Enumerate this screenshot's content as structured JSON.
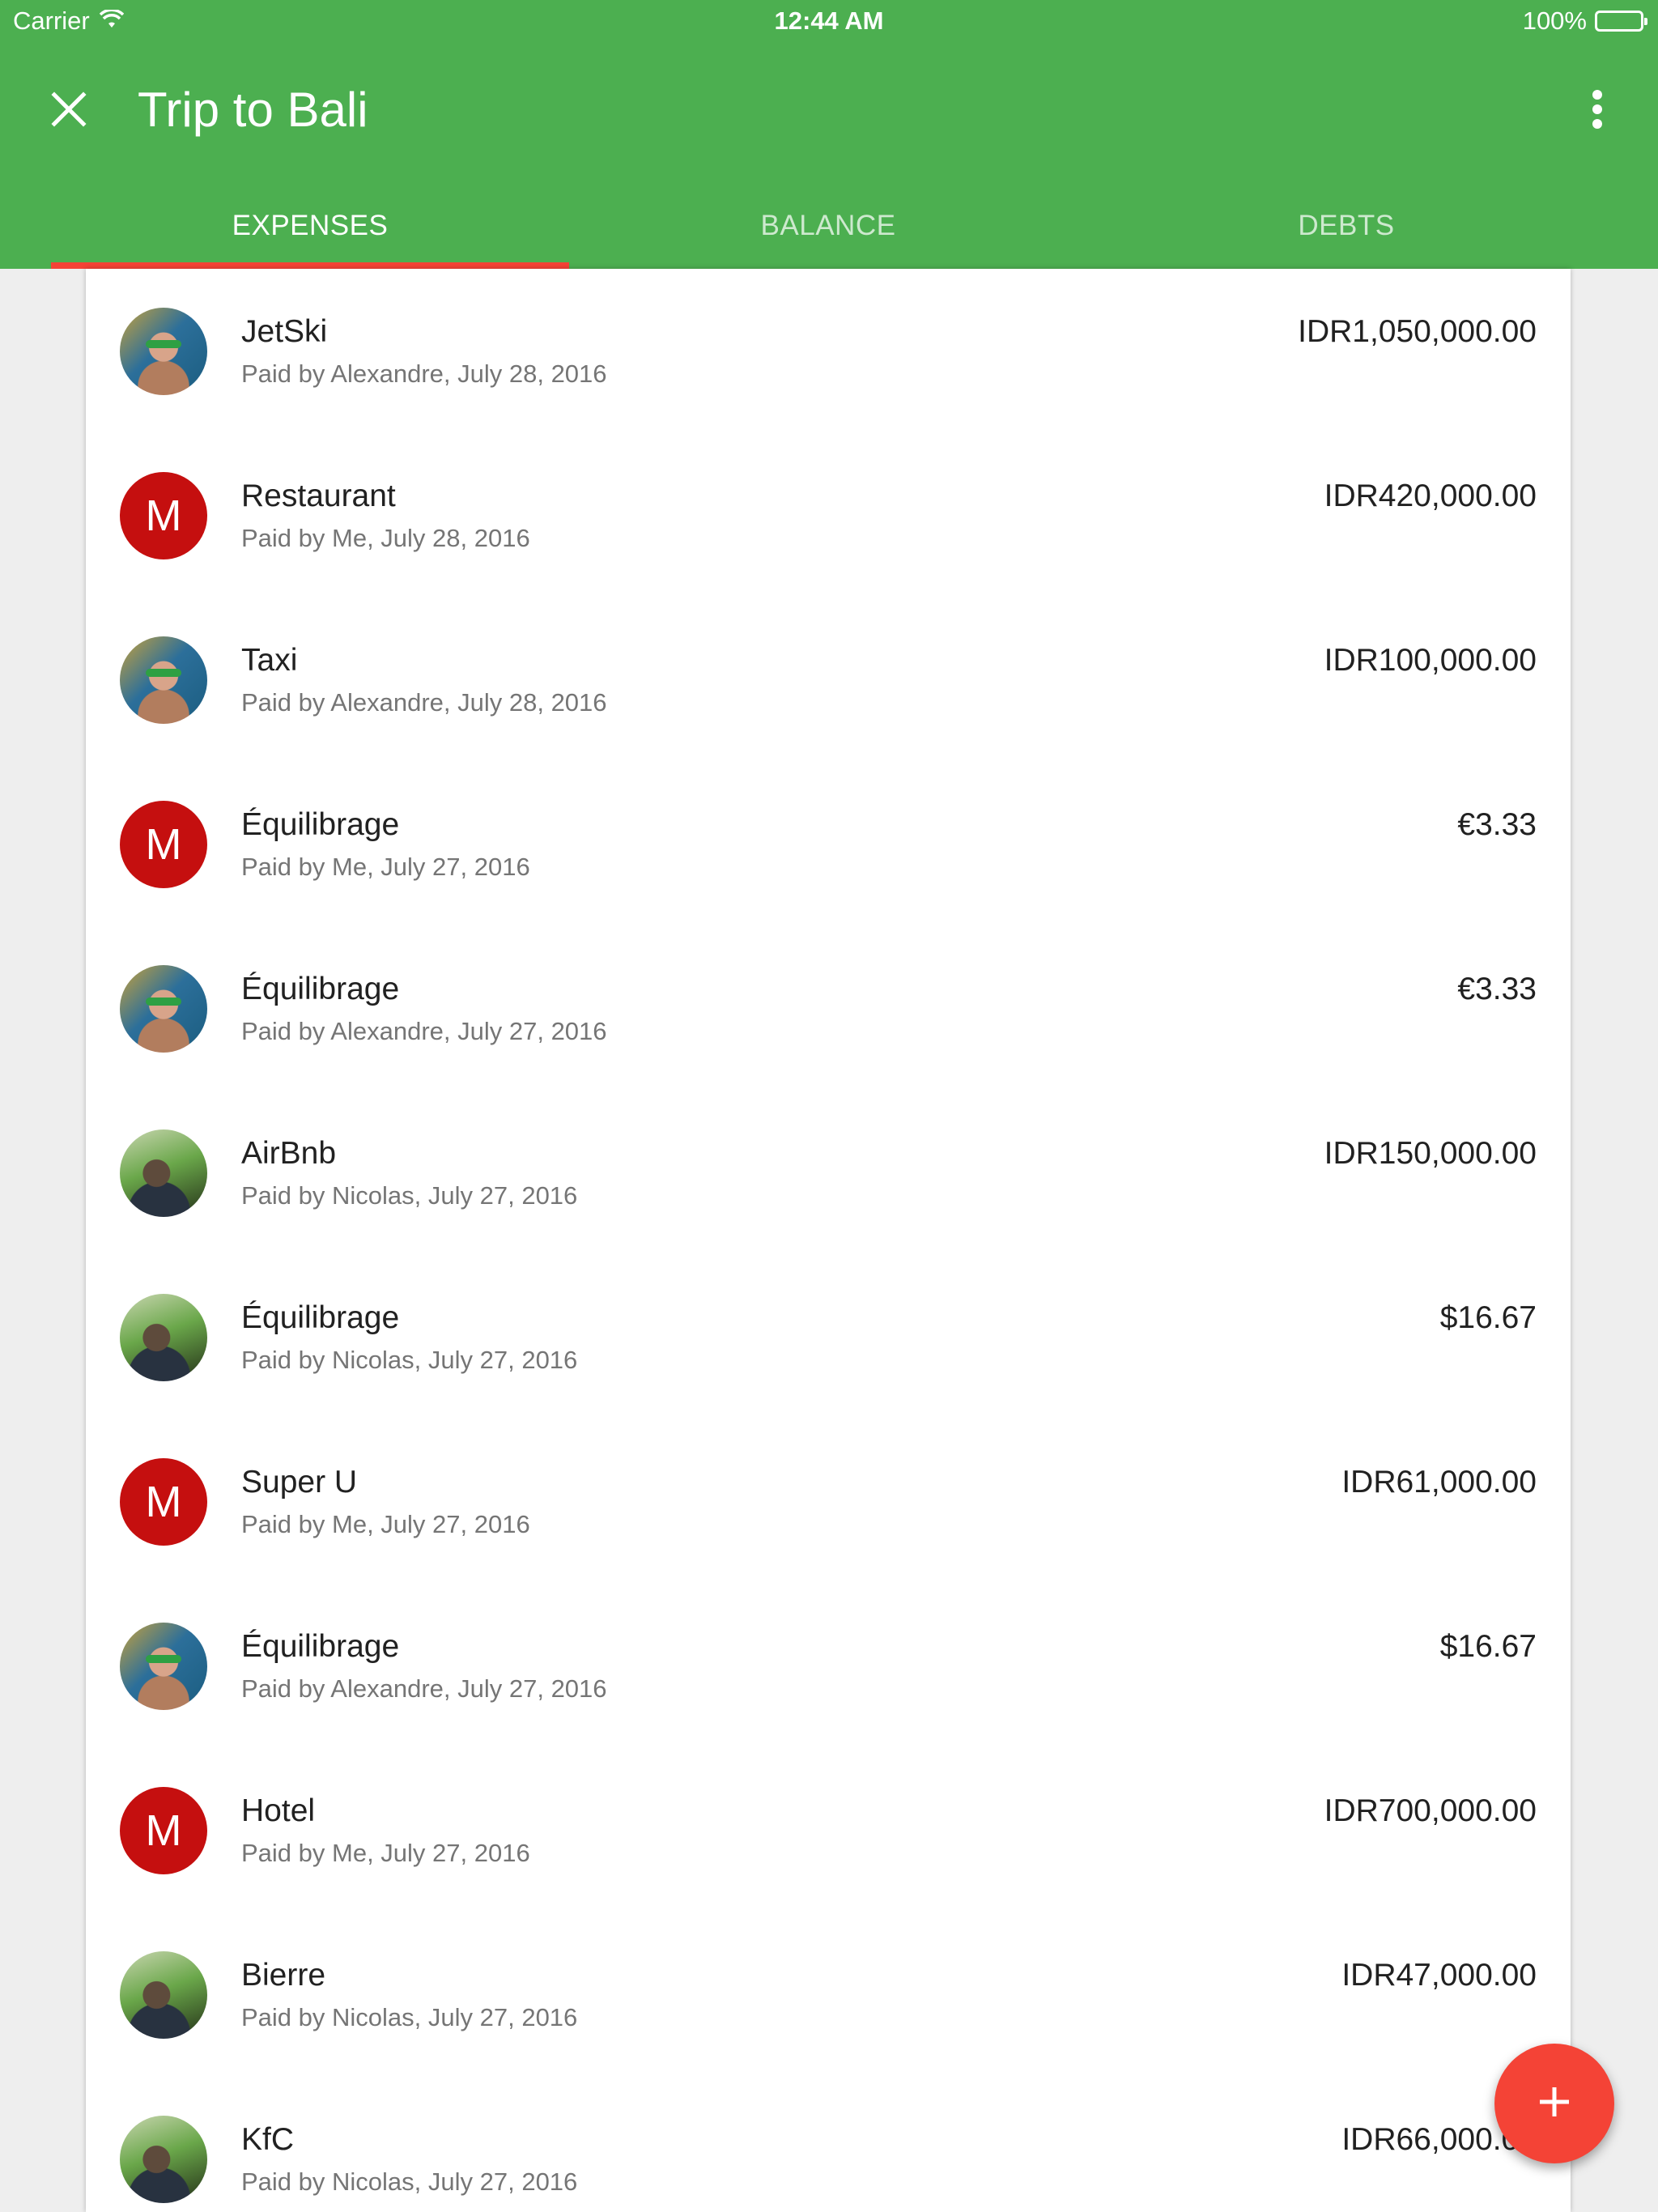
{
  "status_bar": {
    "carrier": "Carrier",
    "time": "12:44 AM",
    "battery": "100%",
    "icons": [
      "wifi-icon",
      "battery-icon"
    ]
  },
  "app_bar": {
    "title": "Trip to Bali",
    "close_icon": "close-icon",
    "more_icon": "more-vert-icon",
    "background_color": "#4caf50"
  },
  "tabs": [
    {
      "label": "EXPENSES",
      "active": true
    },
    {
      "label": "BALANCE",
      "active": false
    },
    {
      "label": "DEBTS",
      "active": false
    }
  ],
  "accent_color": "#f44336",
  "expenses": [
    {
      "name": "JetSki",
      "meta": "Paid by Alexandre, July 28, 2016",
      "amount": "IDR1,050,000.00",
      "avatar": "alexandre-photo"
    },
    {
      "name": "Restaurant",
      "meta": "Paid by Me, July 28, 2016",
      "amount": "IDR420,000.00",
      "avatar": "M"
    },
    {
      "name": "Taxi",
      "meta": "Paid by Alexandre, July 28, 2016",
      "amount": "IDR100,000.00",
      "avatar": "alexandre-photo"
    },
    {
      "name": "Équilibrage",
      "meta": "Paid by Me, July 27, 2016",
      "amount": "€3.33",
      "avatar": "M"
    },
    {
      "name": "Équilibrage",
      "meta": "Paid by Alexandre, July 27, 2016",
      "amount": "€3.33",
      "avatar": "alexandre-photo"
    },
    {
      "name": "AirBnb",
      "meta": "Paid by Nicolas, July 27, 2016",
      "amount": "IDR150,000.00",
      "avatar": "nicolas-photo"
    },
    {
      "name": "Équilibrage",
      "meta": "Paid by Nicolas, July 27, 2016",
      "amount": "$16.67",
      "avatar": "nicolas-photo"
    },
    {
      "name": "Super U",
      "meta": "Paid by Me, July 27, 2016",
      "amount": "IDR61,000.00",
      "avatar": "M"
    },
    {
      "name": "Équilibrage",
      "meta": "Paid by Alexandre, July 27, 2016",
      "amount": "$16.67",
      "avatar": "alexandre-photo"
    },
    {
      "name": "Hotel",
      "meta": "Paid by Me, July 27, 2016",
      "amount": "IDR700,000.00",
      "avatar": "M"
    },
    {
      "name": "Bierre",
      "meta": "Paid by Nicolas, July 27, 2016",
      "amount": "IDR47,000.00",
      "avatar": "nicolas-photo"
    },
    {
      "name": "KfC",
      "meta": "Paid by Nicolas, July 27, 2016",
      "amount": "IDR66,000.00",
      "avatar": "nicolas-photo"
    }
  ],
  "fab": {
    "icon": "plus-icon"
  }
}
